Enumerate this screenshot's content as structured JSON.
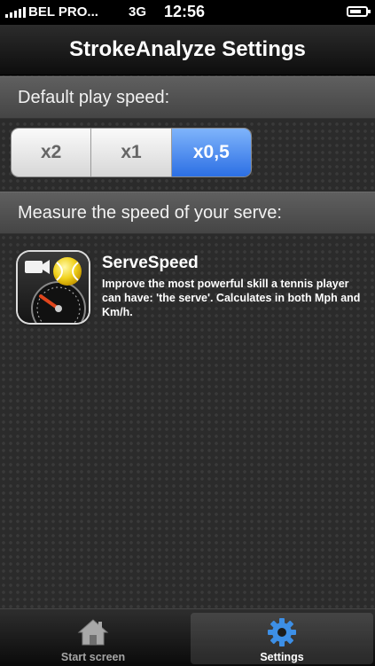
{
  "status_bar": {
    "carrier": "BEL PRO...",
    "network": "3G",
    "time": "12:56",
    "signal_icon": "signal-bars-icon",
    "battery_icon": "battery-icon"
  },
  "nav": {
    "title": "StrokeAnalyze Settings"
  },
  "speed_section": {
    "header": "Default play speed:",
    "options": [
      "x2",
      "x1",
      "x0,5"
    ],
    "selected": "x0,5"
  },
  "serve_section": {
    "header": "Measure the speed of your serve:",
    "app": {
      "title": "ServeSpeed",
      "description": "Improve the most powerful skill a tennis player can have: 'the serve'. Calculates in both Mph and Km/h.",
      "icon": "servespeed-app-icon"
    }
  },
  "tab_bar": {
    "tabs": [
      {
        "label": "Start screen",
        "icon": "home-icon",
        "selected": false
      },
      {
        "label": "Settings",
        "icon": "gear-icon",
        "selected": true
      }
    ]
  },
  "colors": {
    "accent": "#2c6fe4",
    "settings_gear": "#3d8fe6"
  }
}
